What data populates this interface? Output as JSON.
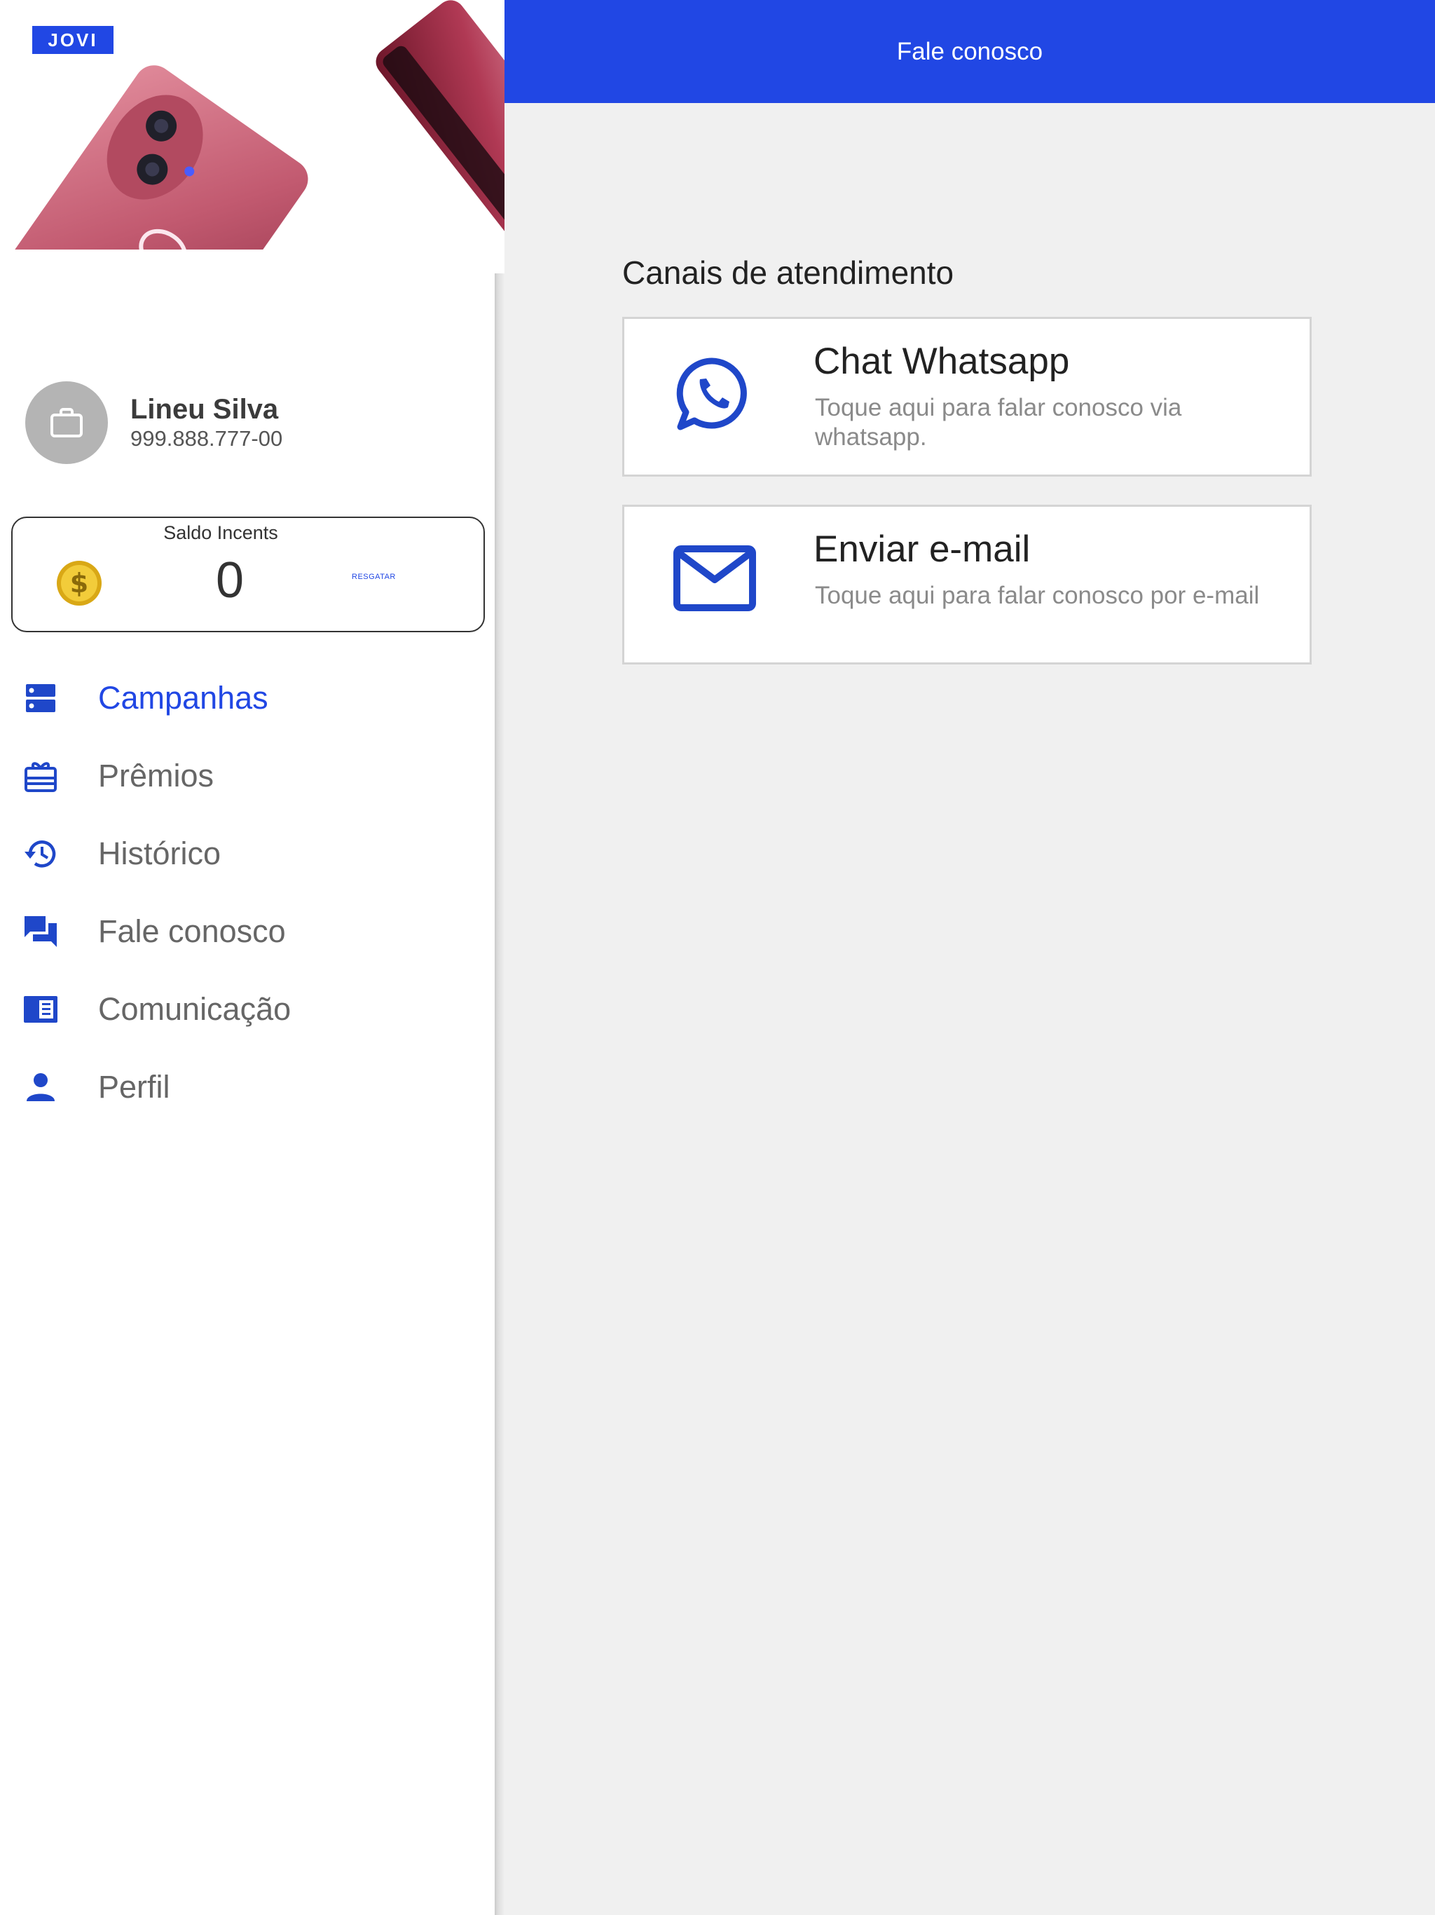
{
  "brand": {
    "logo_text": "JOVI"
  },
  "colors": {
    "accent": "#2147e4",
    "background": "#f0f0f0",
    "muted_text": "#8a8a8a"
  },
  "profile": {
    "name": "Lineu Silva",
    "document": "999.888.777-00",
    "avatar_icon": "briefcase-icon"
  },
  "balance": {
    "label": "Saldo Incents",
    "value": "0",
    "redeem_label": "RESGATAR",
    "icon": "coin-icon"
  },
  "menu": {
    "items": [
      {
        "label": "Campanhas",
        "icon": "campaigns-icon",
        "active": true
      },
      {
        "label": "Prêmios",
        "icon": "gift-card-icon",
        "active": false
      },
      {
        "label": "Histórico",
        "icon": "history-icon",
        "active": false
      },
      {
        "label": "Fale conosco",
        "icon": "chat-icon",
        "active": false
      },
      {
        "label": "Comunicação",
        "icon": "newspaper-icon",
        "active": false
      },
      {
        "label": "Perfil",
        "icon": "person-icon",
        "active": false
      }
    ]
  },
  "header": {
    "title": "Fale conosco"
  },
  "main": {
    "section_title": "Canais de atendimento",
    "channels": [
      {
        "title": "Chat Whatsapp",
        "description": "Toque aqui para falar conosco via whatsapp.",
        "icon": "whatsapp-icon"
      },
      {
        "title": "Enviar e-mail",
        "description": "Toque aqui para falar conosco por e-mail",
        "icon": "mail-icon"
      }
    ]
  }
}
